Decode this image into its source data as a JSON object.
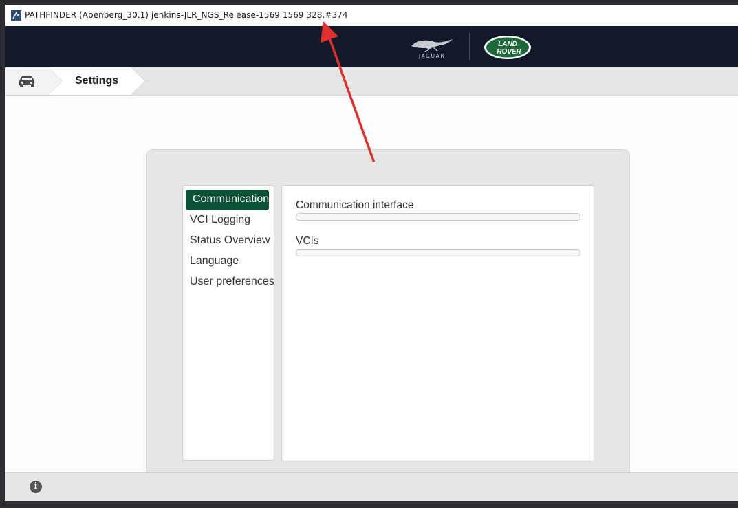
{
  "window": {
    "title": "PATHFINDER (Abenberg_30.1) jenkins-JLR_NGS_Release-1569 1569 328.#374"
  },
  "brand": {
    "jaguar_logo": "JAGUAR",
    "landrover_logo_line1": "LAND",
    "landrover_logo_line2": "ROVER"
  },
  "breadcrumb": {
    "home_icon": "car-icon",
    "current": "Settings"
  },
  "settings": {
    "menu": [
      {
        "label": "Communication",
        "active": true
      },
      {
        "label": "VCI Logging",
        "active": false
      },
      {
        "label": "Status Overview",
        "active": false
      },
      {
        "label": "Language",
        "active": false
      },
      {
        "label": "User preferences",
        "active": false
      }
    ],
    "fields": [
      {
        "label": "Communication interface",
        "value": ""
      },
      {
        "label": "VCIs",
        "value": ""
      }
    ]
  },
  "footer": {
    "info_icon": "info-icon",
    "info_glyph": "i"
  },
  "colors": {
    "brand_bar": "#121a2a",
    "active_menu": "#0a5233",
    "annotation_arrow": "#e0302b"
  }
}
